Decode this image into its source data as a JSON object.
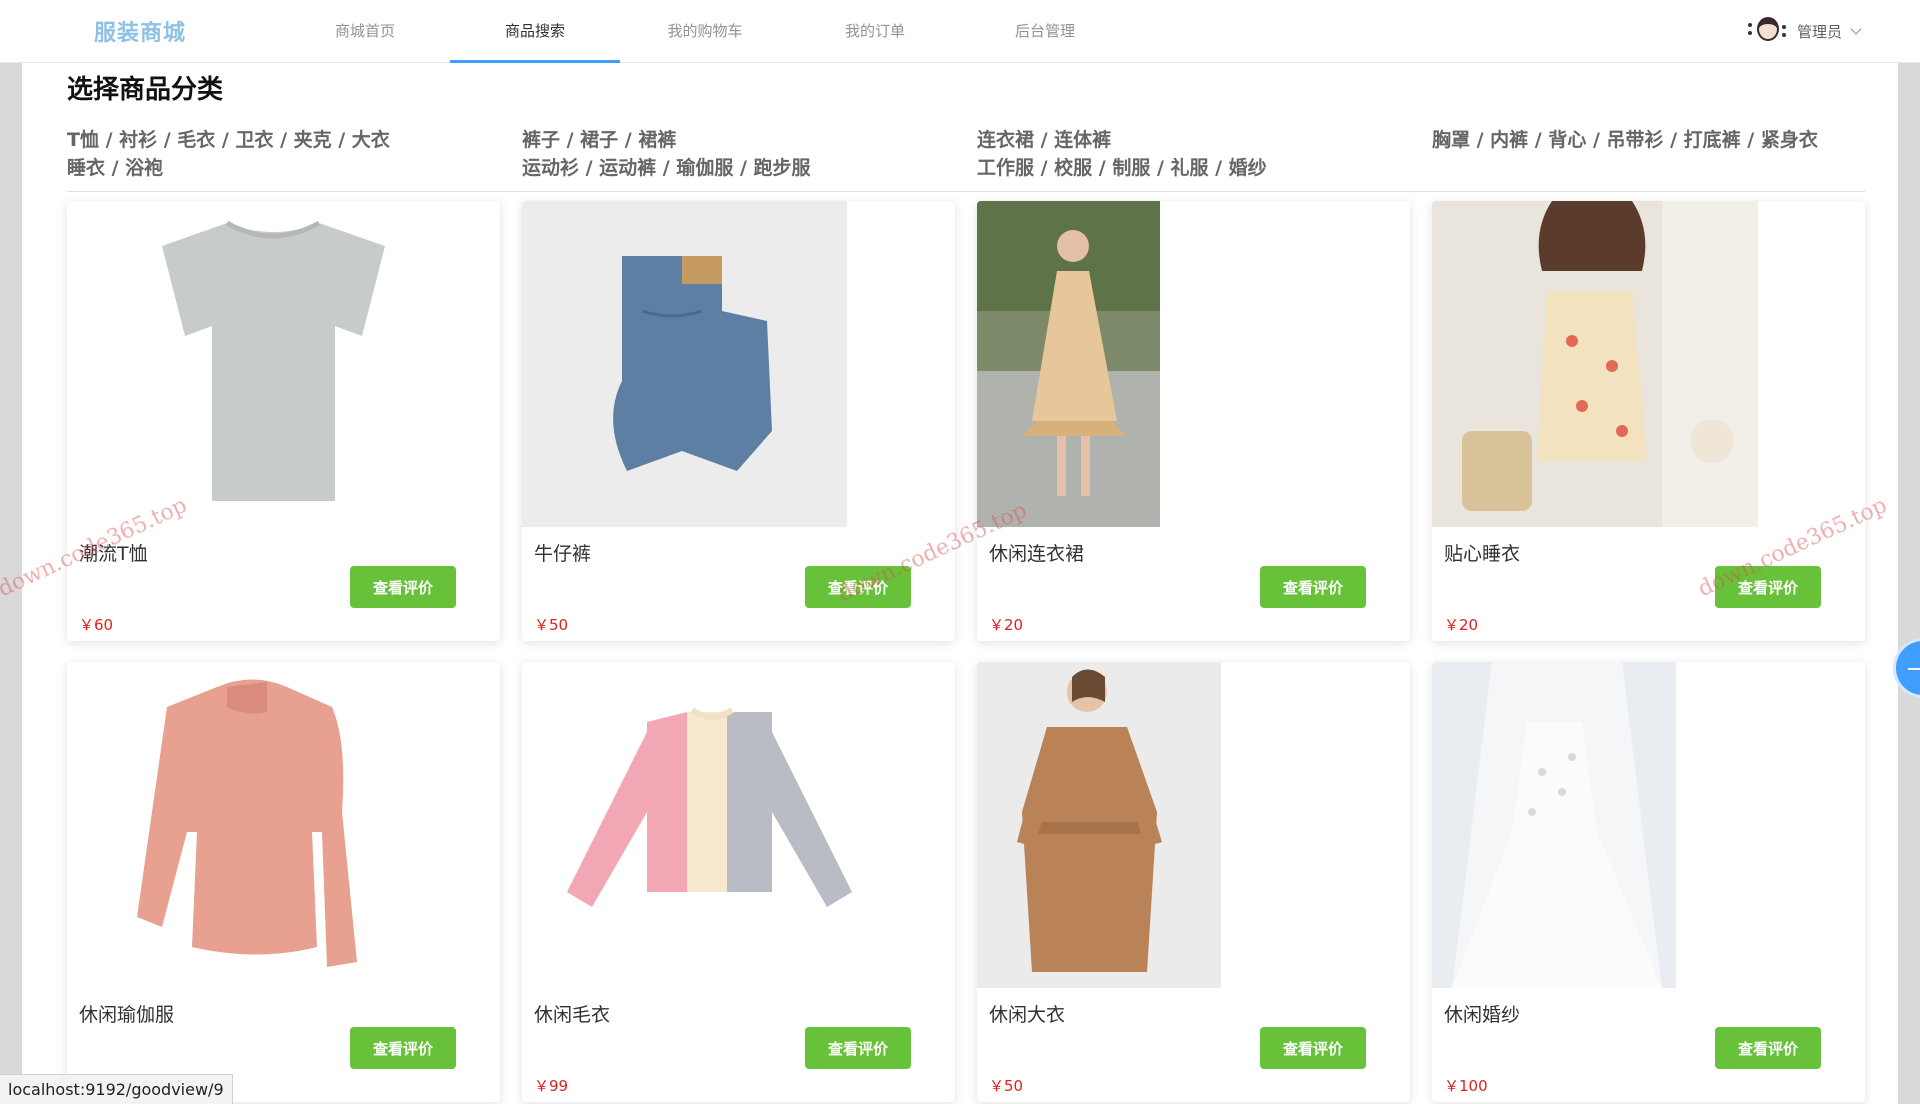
{
  "nav": {
    "brand": "服装商城",
    "items": [
      {
        "label": "商城首页"
      },
      {
        "label": "商品搜索"
      },
      {
        "label": "我的购物车"
      },
      {
        "label": "我的订单"
      },
      {
        "label": "后台管理"
      }
    ],
    "active_index": 1,
    "user_name": "管理员"
  },
  "section_title": "选择商品分类",
  "categories": [
    {
      "lines": [
        "T恤 / 衬衫 / 毛衣 / 卫衣 / 夹克 / 大衣",
        "睡衣 / 浴袍"
      ]
    },
    {
      "lines": [
        "裤子 / 裙子 / 裙裤",
        "运动衫 / 运动裤 / 瑜伽服 / 跑步服"
      ]
    },
    {
      "lines": [
        "连衣裙 / 连体裤",
        "工作服 / 校服 / 制服 / 礼服 / 婚纱"
      ]
    },
    {
      "lines": [
        "胸罩 / 内裤 / 背心 / 吊带衫 / 打底裤 / 紧身衣"
      ]
    }
  ],
  "products": [
    {
      "name": "潮流T恤",
      "price": "￥60",
      "button": "查看评价",
      "image": "gray-tshirt"
    },
    {
      "name": "牛仔裤",
      "price": "￥50",
      "button": "查看评价",
      "image": "folded-jeans"
    },
    {
      "name": "休闲连衣裙",
      "price": "￥20",
      "button": "查看评价",
      "image": "floral-dress-model"
    },
    {
      "name": "贴心睡衣",
      "price": "￥20",
      "button": "查看评价",
      "image": "pajama-model"
    },
    {
      "name": "休闲瑜伽服",
      "price": "",
      "button": "查看评价",
      "image": "pink-yoga-top"
    },
    {
      "name": "休闲毛衣",
      "price": "￥99",
      "button": "查看评价",
      "image": "colorblock-sweater"
    },
    {
      "name": "休闲大衣",
      "price": "￥50",
      "button": "查看评价",
      "image": "camel-coat-model"
    },
    {
      "name": "休闲婚纱",
      "price": "￥100",
      "button": "查看评价",
      "image": "wedding-dress"
    }
  ],
  "watermark": "down.code365.top",
  "status_url": "localhost:9192/goodview/9",
  "colors": {
    "accent": "#409eff",
    "button": "#67c23a",
    "price": "#e02020",
    "brand": "#8ec1e6"
  }
}
